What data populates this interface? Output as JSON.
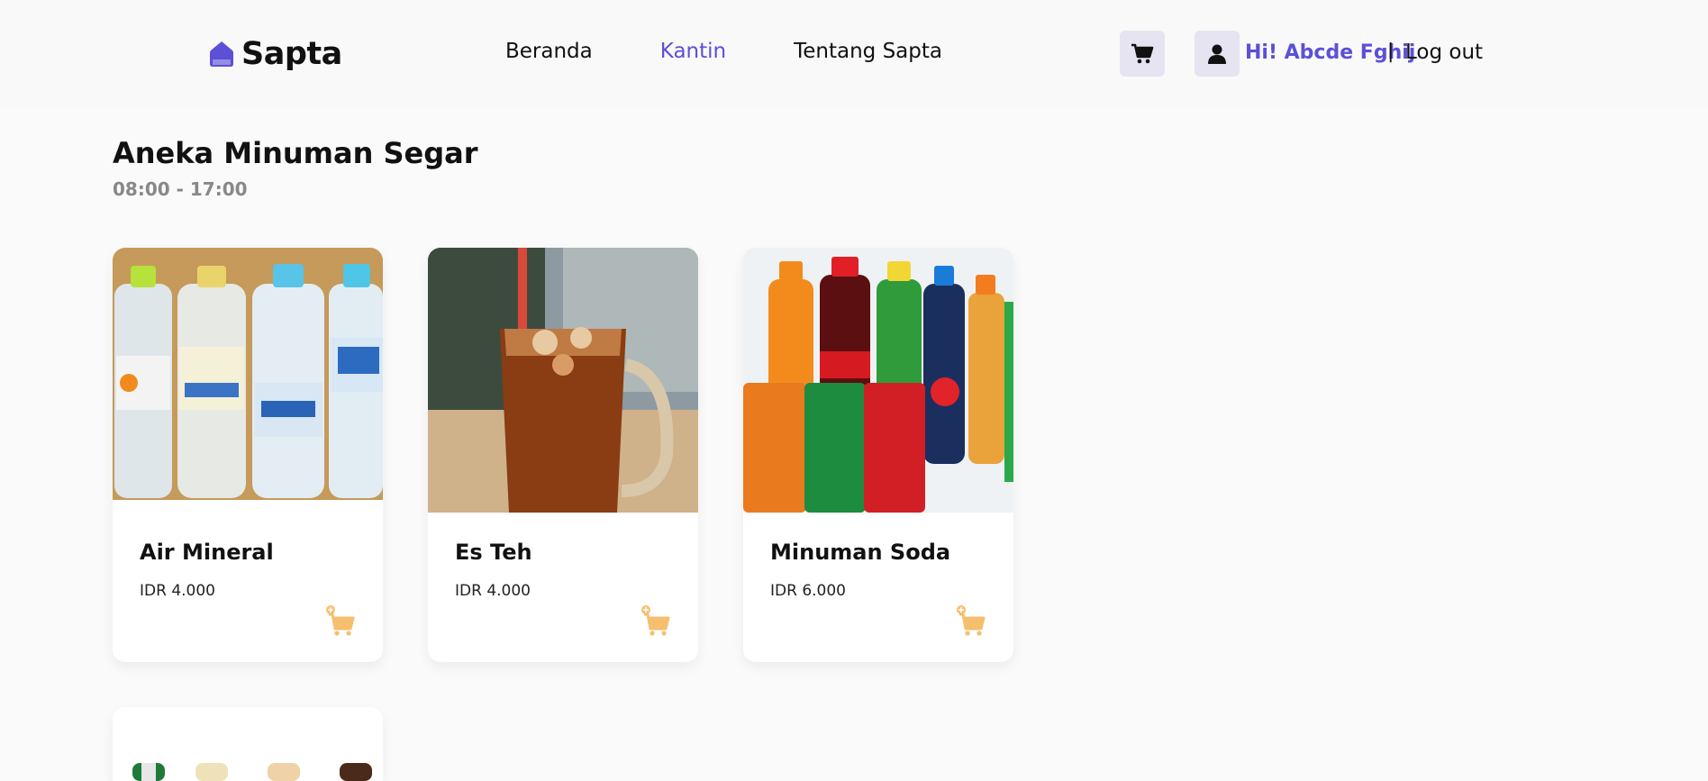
{
  "brand": {
    "name": "Sapta",
    "accent": "#5b50d6"
  },
  "nav": {
    "items": [
      {
        "label": "Beranda",
        "active": false
      },
      {
        "label": "Kantin",
        "active": true
      },
      {
        "label": "Tentang Sapta",
        "active": false
      }
    ]
  },
  "header": {
    "cart_icon": "cart-icon",
    "user_icon": "user-icon",
    "greeting": "Hi! Abcde Fghij",
    "separator": "|",
    "logout_label": "Log out"
  },
  "store": {
    "title": "Aneka Minuman Segar",
    "hours": "08:00 - 17:00"
  },
  "products": [
    {
      "name": "Air Mineral",
      "price": "IDR 4.000"
    },
    {
      "name": "Es Teh",
      "price": "IDR 4.000"
    },
    {
      "name": "Minuman Soda",
      "price": "IDR 6.000"
    }
  ],
  "colors": {
    "add_cart": "#f6bf6e",
    "background": "#fafafa"
  }
}
